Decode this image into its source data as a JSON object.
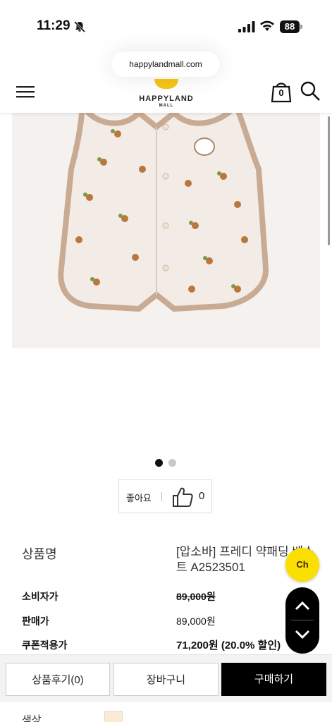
{
  "status_bar": {
    "time": "11:29",
    "battery": "88"
  },
  "browser": {
    "url": "happylandmall.com"
  },
  "header": {
    "logo_name": "HAPPYLAND",
    "logo_sub": "MALL",
    "cart_count": "0"
  },
  "carousel": {
    "total": 2,
    "active": 1
  },
  "like": {
    "label": "좋아요",
    "count": "0"
  },
  "product": {
    "name_label": "상품명",
    "name_value": "[압소바] 프레디 약패딩 베스트 A2523501",
    "consumer_price_label": "소비자가",
    "consumer_price": "89,000원",
    "sale_price_label": "판매가",
    "sale_price": "89,000원",
    "coupon_price_label": "쿠폰적용가",
    "coupon_price": "71,200원 (20.0% 할인)",
    "color_label": "색상"
  },
  "floating": {
    "kakao_label": "Ch"
  },
  "actions": {
    "review": "상품후기(0)",
    "cart": "장바구니",
    "buy": "구매하기"
  },
  "colors": {
    "accent": "#000000",
    "kakao": "#f9e000",
    "logo_sun": "#f5c518",
    "swatch": "#fbebd4"
  }
}
